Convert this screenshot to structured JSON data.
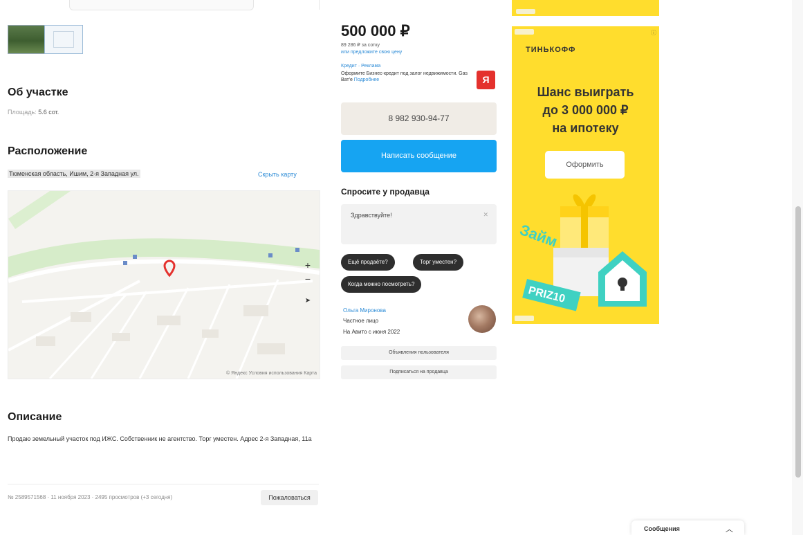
{
  "about": {
    "title": "Об участке",
    "area_label": "Площадь:",
    "area_value": "5.6 сот."
  },
  "location": {
    "title": "Расположение",
    "address": "Тюменская область, Ишим, 2-я Западная ул.",
    "show_map": "Скрыть карту"
  },
  "map": {
    "zoom_in": "+",
    "zoom_out": "−",
    "attribution": "© Яндекс  Условия использования  Карта"
  },
  "description": {
    "title": "Описание",
    "text": "Продаю земельный участок под ИЖС. Собственник не агентство. Торг уместен. Адрес 2-я Западная, 11а"
  },
  "footer": {
    "meta": "№ 2589571568 · 11 ноября 2023 · 2495 просмотров (+3 сегодня)",
    "complain": "Пожаловаться"
  },
  "price": {
    "amount": "500 000 ₽",
    "per_unit": "89 286 ₽ за сотку",
    "note": "или предложите свою цену"
  },
  "loan": {
    "label": "Кредит · Реклама",
    "text": "Оформите Бизнес-кредит под залог недвижимости. Gas Ват'е",
    "link": "Подробнее"
  },
  "contact": {
    "phone": "8 982 930-94-77",
    "message_button": "Написать сообщение"
  },
  "ask": {
    "title": "Спросите у продавца",
    "placeholder": "Здравствуйте!",
    "chips": [
      "Ещё продаёте?",
      "Торг уместен?",
      "Когда можно посмотреть?"
    ]
  },
  "seller": {
    "name": "Ольга Миронова",
    "type": "Частное лицо",
    "since": "На Авито с июня 2022",
    "btn_subscribe": "Подписаться на продавца",
    "btn_other": "Объявления пользователя"
  },
  "ad": {
    "brand": "ТИНЬКОФФ",
    "headline_1": "Шанс выиграть",
    "headline_2": "до 3 000 000 ₽",
    "headline_3": "на ипотеку",
    "cta": "Оформить",
    "promo": "PRIZ10",
    "mascot": "Займ"
  },
  "messages_bar": {
    "title": "Сообщения",
    "chevron": "︿"
  },
  "colors": {
    "accent": "#16a4f2",
    "ad_bg": "#ffdd2d",
    "chip_bg": "#2e2e2e",
    "loan_icon": "#e4312d"
  }
}
